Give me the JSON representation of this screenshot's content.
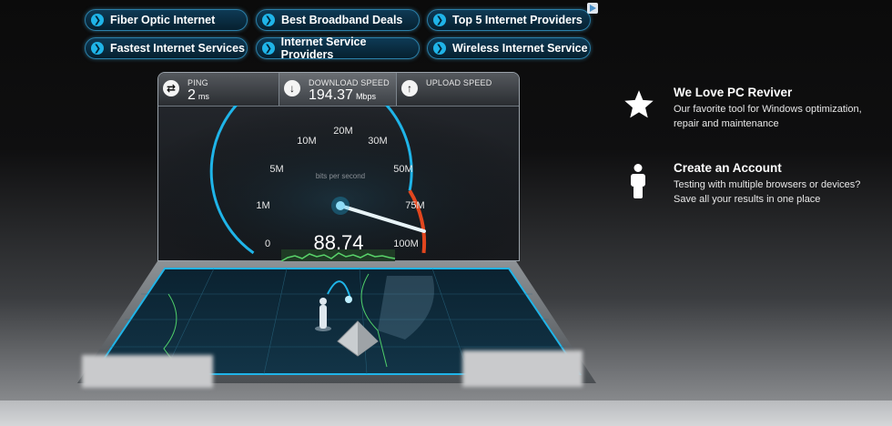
{
  "ads": [
    {
      "label": "Fiber Optic Internet"
    },
    {
      "label": "Best Broadband Deals"
    },
    {
      "label": "Top 5 Internet Providers"
    },
    {
      "label": "Fastest Internet Services"
    },
    {
      "label": "Internet Service Providers"
    },
    {
      "label": "Wireless Internet Service"
    }
  ],
  "speed": {
    "ping": {
      "label": "PING",
      "value": "2",
      "unit": "ms"
    },
    "download": {
      "label": "DOWNLOAD SPEED",
      "value": "194.37",
      "unit": "Mbps"
    },
    "upload": {
      "label": "UPLOAD SPEED"
    }
  },
  "gauge": {
    "units_label": "bits per second",
    "reading": "88.74",
    "reading_value": 88.74,
    "ticks": [
      "0",
      "1M",
      "5M",
      "10M",
      "20M",
      "30M",
      "50M",
      "75M",
      "100M"
    ]
  },
  "promos": [
    {
      "title": "We Love PC Reviver",
      "text": "Our favorite tool for Windows optimization, repair and maintenance"
    },
    {
      "title": "Create an Account",
      "text": "Testing with multiple browsers or devices? Save all your results in one place"
    }
  ],
  "colors": {
    "accent": "#1fb4e8",
    "danger": "#e2461e",
    "panel_bg": "#1d2024"
  }
}
